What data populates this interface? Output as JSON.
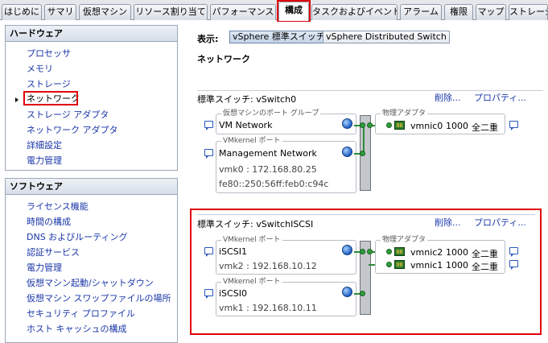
{
  "tabs": [
    "はじめに",
    "サマリ",
    "仮想マシン",
    "リソース割り当て",
    "パフォーマンス",
    "構成",
    "タスクおよびイベント",
    "アラーム",
    "権限",
    "マップ",
    "ストレージ"
  ],
  "hardware": {
    "title": "ハードウェア",
    "items": [
      "プロセッサ",
      "メモリ",
      "ストレージ",
      "ネットワーク",
      "ストレージ アダプタ",
      "ネットワーク アダプタ",
      "詳細設定",
      "電力管理"
    ]
  },
  "software": {
    "title": "ソフトウェア",
    "items": [
      "ライセンス機能",
      "時間の構成",
      "DNS およびルーティング",
      "認証サービス",
      "電力管理",
      "仮想マシン起動/シャットダウン",
      "仮想マシン スワップファイルの場所",
      "セキュリティ プロファイル",
      "ホスト キャッシュの構成"
    ]
  },
  "view": {
    "label": "表示:",
    "btn_standard": "vSphere 標準スイッチ",
    "btn_distributed": "vSphere Distributed Switch",
    "section": "ネットワーク"
  },
  "switch0": {
    "title": "標準スイッチ: vSwitch0",
    "remove": "削除...",
    "properties": "プロパティ...",
    "vm_group_caption": "仮想マシンのポート グループ",
    "vm_network": "VM Network",
    "vmk_caption": "VMkernel ポート",
    "mgmt_name": "Management Network",
    "mgmt_ip": "vmk0 : 172.168.80.25",
    "mgmt_ipv6": "fe80::250:56ff:feb0:c94c",
    "adapter_caption": "物理アダプタ",
    "nic_name": "vmnic0",
    "nic_speed": "1000",
    "nic_duplex": "全二重"
  },
  "switch_iscsi": {
    "title": "標準スイッチ: vSwitchISCSI",
    "remove": "削除...",
    "properties": "プロパティ...",
    "port1_caption": "VMkernel ポート",
    "port1_name": "iSCSI1",
    "port1_ip": "vmk2 : 192.168.10.12",
    "port2_caption": "VMkernel ポート",
    "port2_name": "iSCSI0",
    "port2_ip": "vmk1 : 192.168.10.11",
    "adapter_caption": "物理アダプタ",
    "nic1_name": "vmnic2",
    "nic1_speed": "1000",
    "nic1_duplex": "全二重",
    "nic2_name": "vmnic1",
    "nic2_speed": "1000",
    "nic2_duplex": "全二重"
  },
  "colors": {
    "highlight": "#e0000a",
    "link": "#1a36a8",
    "line": "#2e8a3a"
  }
}
